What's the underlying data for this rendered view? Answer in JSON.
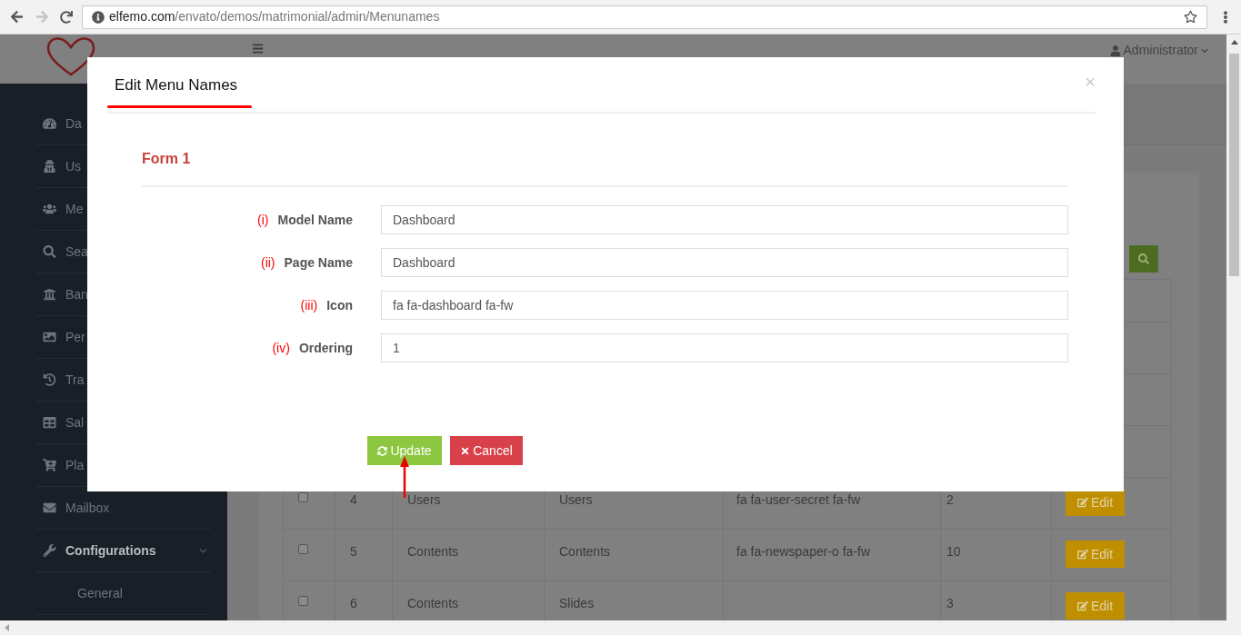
{
  "browser": {
    "url_host": "elfemo.com",
    "url_path": "/envato/demos/matrimonial/admin/Menunames"
  },
  "header": {
    "user": "Administrator"
  },
  "sidebar": {
    "items": [
      {
        "label": "Da",
        "selected": false
      },
      {
        "label": "Us",
        "selected": false
      },
      {
        "label": "Me",
        "selected": false
      },
      {
        "label": "Sea",
        "selected": false
      },
      {
        "label": "Ban",
        "selected": false
      },
      {
        "label": "Per",
        "selected": false
      },
      {
        "label": "Tra",
        "selected": false
      },
      {
        "label": "Sal",
        "selected": false
      },
      {
        "label": "Pla",
        "selected": false
      },
      {
        "label": "Mailbox",
        "selected": false
      },
      {
        "label": "Configurations",
        "selected": true,
        "expanded": true,
        "children": [
          {
            "label": "General",
            "selected": false
          }
        ]
      }
    ]
  },
  "table": {
    "rows": [
      {
        "checked": false,
        "number": "4",
        "model": "Users",
        "page": "Users",
        "icon": "fa fa-user-secret fa-fw",
        "ordering": "2",
        "action": "Edit"
      },
      {
        "checked": false,
        "number": "5",
        "model": "Contents",
        "page": "Contents",
        "icon": "fa fa-newspaper-o fa-fw",
        "ordering": "10",
        "action": "Edit"
      },
      {
        "checked": false,
        "number": "6",
        "model": "Contents",
        "page": "Slides",
        "ordering": "3",
        "action": "Edit"
      }
    ]
  },
  "modal": {
    "title": "Edit Menu Names",
    "close": "×",
    "section": "Form 1",
    "fields": [
      {
        "index": "(i)",
        "label": "Model Name",
        "value": "Dashboard"
      },
      {
        "index": "(ii)",
        "label": "Page Name",
        "value": "Dashboard"
      },
      {
        "index": "(iii)",
        "label": "Icon",
        "value": "fa fa-dashboard fa-fw"
      },
      {
        "index": "(iv)",
        "label": "Ordering",
        "value": "1"
      }
    ],
    "buttons": [
      {
        "kind": "update",
        "label": "Update"
      },
      {
        "kind": "cancel",
        "label": "Cancel"
      }
    ]
  }
}
